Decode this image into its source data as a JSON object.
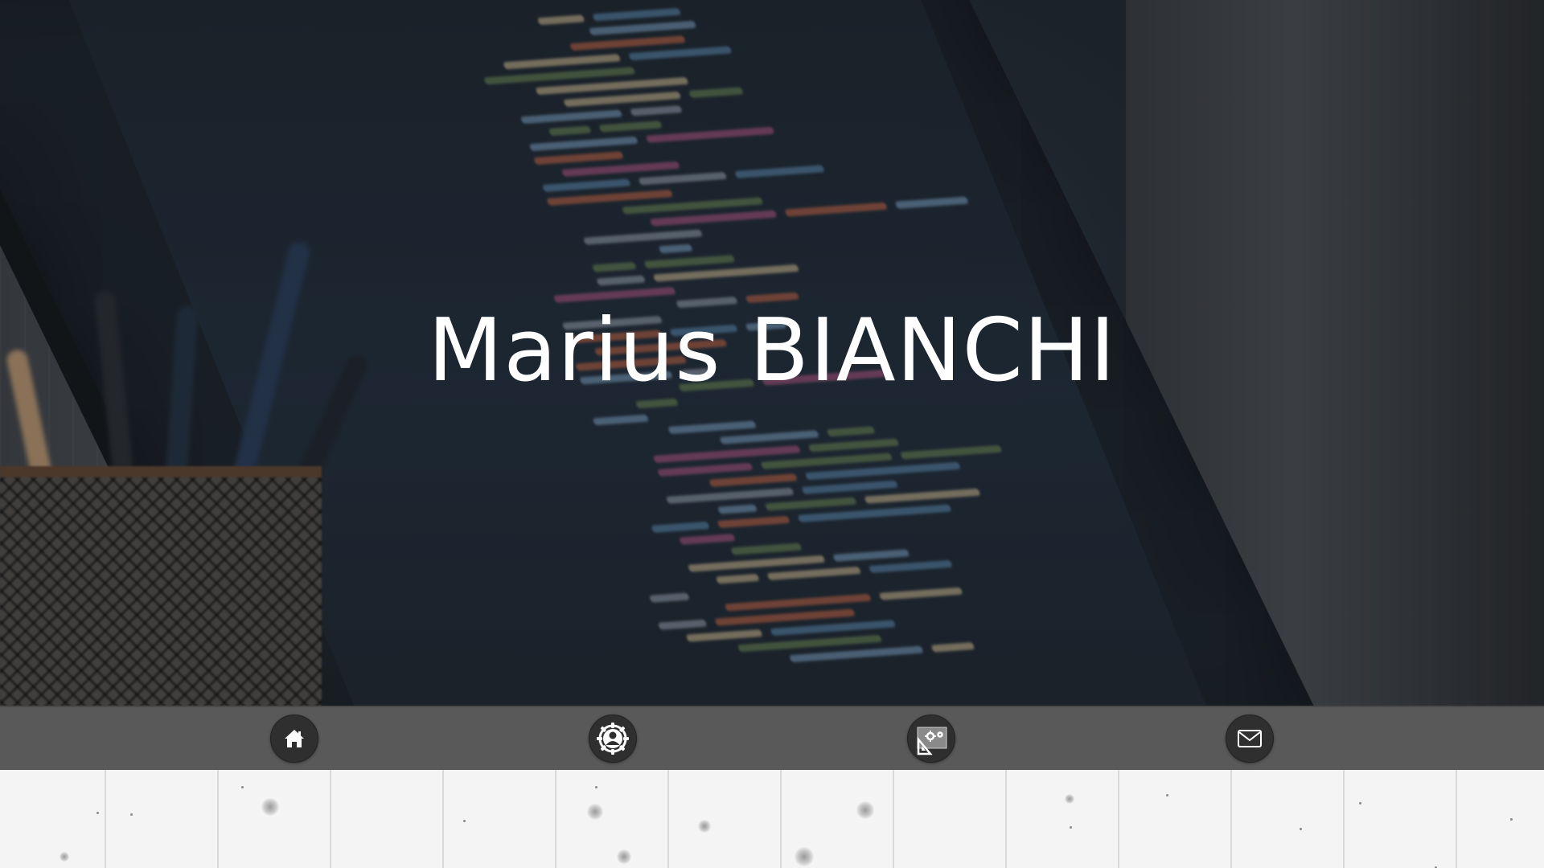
{
  "hero": {
    "title": "Marius BIANCHI"
  },
  "nav": {
    "items": [
      {
        "name": "home",
        "icon": "home-icon"
      },
      {
        "name": "about",
        "icon": "profile-gear-icon"
      },
      {
        "name": "skills",
        "icon": "settings-tools-icon"
      },
      {
        "name": "contact",
        "icon": "mail-icon"
      }
    ]
  },
  "colors": {
    "navbar": "#595959",
    "nav_button": "#2f2f2f",
    "title": "#ffffff"
  }
}
